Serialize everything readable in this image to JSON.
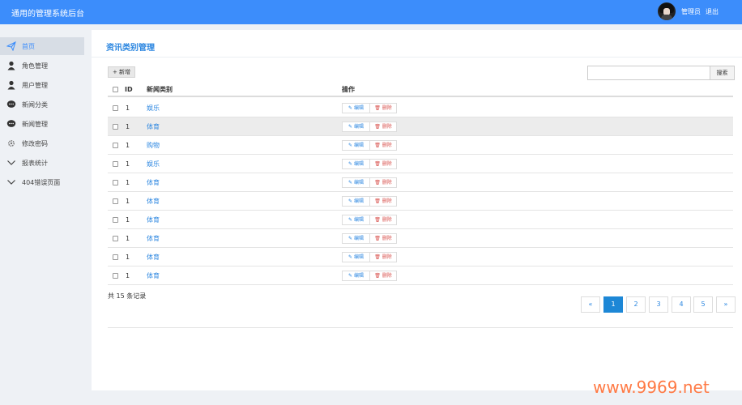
{
  "app": {
    "title": "通用的管理系统后台",
    "user": "管理员",
    "logout": "退出"
  },
  "sidebar": {
    "items": [
      {
        "label": "首页",
        "icon": "paper-plane-icon",
        "active": true
      },
      {
        "label": "角色管理",
        "icon": "user-icon"
      },
      {
        "label": "用户管理",
        "icon": "user-icon"
      },
      {
        "label": "新闻分类",
        "icon": "chat-bubble-icon"
      },
      {
        "label": "新闻管理",
        "icon": "chat-bubble-icon"
      },
      {
        "label": "修改密码",
        "icon": "gear-icon"
      },
      {
        "label": "报表统计",
        "icon": "chevron-down-icon"
      },
      {
        "label": "404错误页面",
        "icon": "chevron-down-icon"
      }
    ]
  },
  "main": {
    "title": "资讯类别管理",
    "add_label": "+ 新增",
    "search_placeholder": "",
    "search_label": "搜索",
    "table": {
      "headers": {
        "id": "ID",
        "category": "新闻类别",
        "actions": "操作"
      },
      "rows": [
        {
          "id": "1",
          "category": "娱乐"
        },
        {
          "id": "1",
          "category": "体育"
        },
        {
          "id": "1",
          "category": "购物"
        },
        {
          "id": "1",
          "category": "娱乐"
        },
        {
          "id": "1",
          "category": "体育"
        },
        {
          "id": "1",
          "category": "体育"
        },
        {
          "id": "1",
          "category": "体育"
        },
        {
          "id": "1",
          "category": "体育"
        },
        {
          "id": "1",
          "category": "体育"
        },
        {
          "id": "1",
          "category": "体育"
        }
      ],
      "edit_label": "编辑",
      "delete_label": "删除"
    },
    "summary": "共 15 条记录",
    "pagination": {
      "prev": "«",
      "pages": [
        "1",
        "2",
        "3",
        "4",
        "5"
      ],
      "current": "1",
      "next": "»"
    }
  },
  "watermark": "www.9969.net",
  "colors": {
    "topbar": "#3c8dfb",
    "accent": "#2b86e0",
    "active_page": "#1d87d6",
    "danger": "#d9534f",
    "watermark": "#ff7a45"
  }
}
